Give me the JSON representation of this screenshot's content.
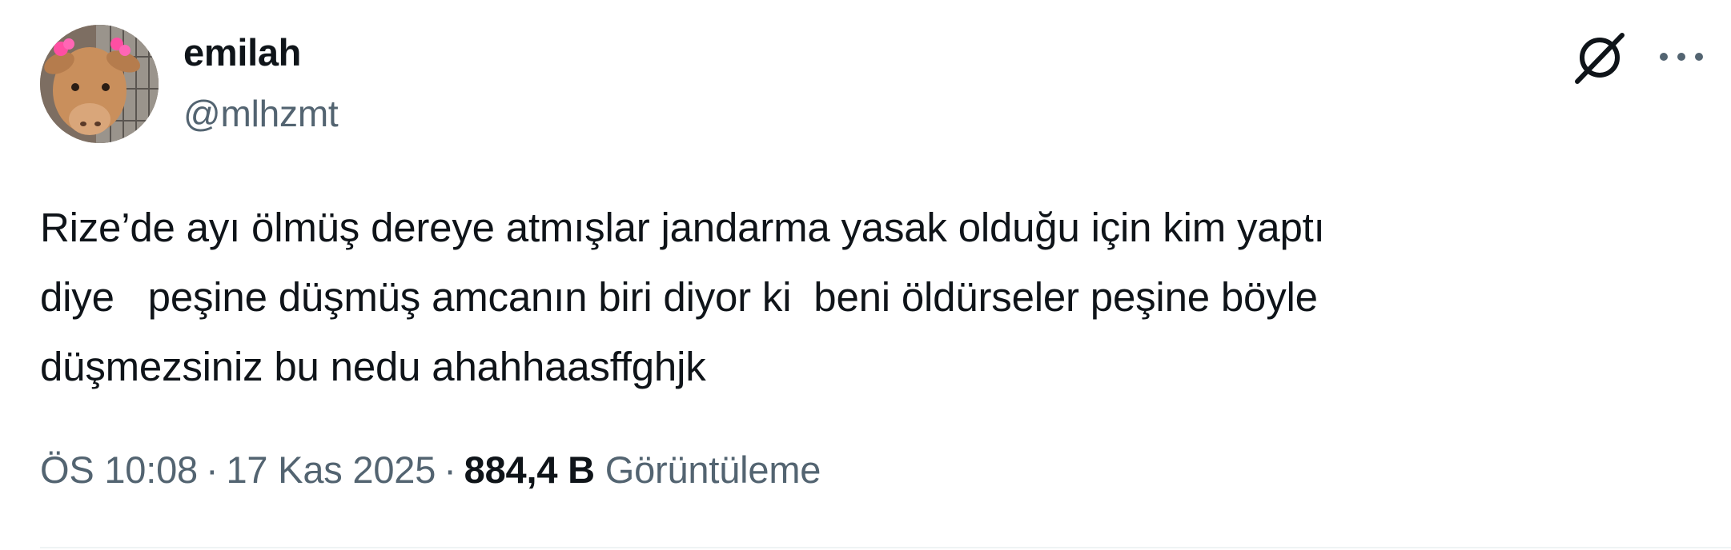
{
  "author": {
    "display_name": "emilah",
    "handle": "@mlhzmt",
    "avatar": "calf-profile-photo"
  },
  "header_actions": {
    "grok_icon": "grok-slash-icon",
    "more_icon": "more-dots-icon"
  },
  "tweet": {
    "text": "Rize’de ayı ölmüş dereye atmışlar jandarma yasak olduğu için kim yaptı\ndiye   peşine düşmüş amcanın biri diyor ki  beni öldürseler peşine böyle\ndüşmezsiniz bu nedu ahahhaasffghjk",
    "time": "ÖS 10:08",
    "date": "17 Kas 2025",
    "separator": "·",
    "views_count": "884,4 B",
    "views_label": "Görüntüleme"
  },
  "colors": {
    "text_primary": "#0f1419",
    "text_secondary": "#536471",
    "divider": "#eff3f4"
  }
}
